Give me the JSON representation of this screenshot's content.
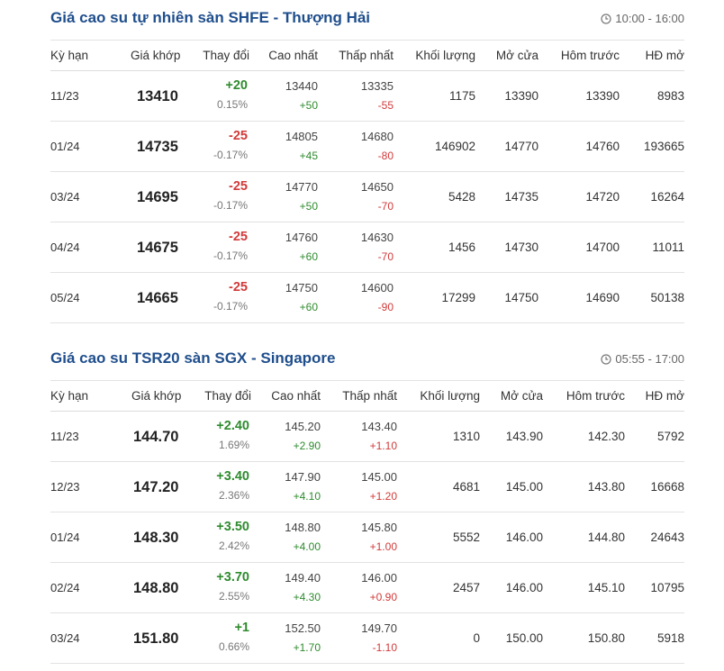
{
  "colors": {
    "title": "#1f4e8c",
    "up": "#2e8b2e",
    "down": "#d23a3a"
  },
  "headers": [
    "Kỳ hạn",
    "Giá khớp",
    "Thay đổi",
    "Cao nhất",
    "Thấp nhất",
    "Khối lượng",
    "Mở cửa",
    "Hôm trước",
    "HĐ mở"
  ],
  "sections": [
    {
      "title": "Giá cao su tự nhiên sàn SHFE - Thượng Hải",
      "time": "10:00 - 16:00",
      "clock_icon": "clock-icon",
      "rows": [
        {
          "term": "11/23",
          "price": "13410",
          "change": "+20",
          "change_dir": "up",
          "pct": "0.15%",
          "high": "13440",
          "high_delta": "+50",
          "high_dir": "up",
          "low": "13335",
          "low_delta": "-55",
          "low_dir": "down",
          "volume": "1175",
          "open": "13390",
          "prev": "13390",
          "oi": "8983"
        },
        {
          "term": "01/24",
          "price": "14735",
          "change": "-25",
          "change_dir": "down",
          "pct": "-0.17%",
          "high": "14805",
          "high_delta": "+45",
          "high_dir": "up",
          "low": "14680",
          "low_delta": "-80",
          "low_dir": "down",
          "volume": "146902",
          "open": "14770",
          "prev": "14760",
          "oi": "193665"
        },
        {
          "term": "03/24",
          "price": "14695",
          "change": "-25",
          "change_dir": "down",
          "pct": "-0.17%",
          "high": "14770",
          "high_delta": "+50",
          "high_dir": "up",
          "low": "14650",
          "low_delta": "-70",
          "low_dir": "down",
          "volume": "5428",
          "open": "14735",
          "prev": "14720",
          "oi": "16264"
        },
        {
          "term": "04/24",
          "price": "14675",
          "change": "-25",
          "change_dir": "down",
          "pct": "-0.17%",
          "high": "14760",
          "high_delta": "+60",
          "high_dir": "up",
          "low": "14630",
          "low_delta": "-70",
          "low_dir": "down",
          "volume": "1456",
          "open": "14730",
          "prev": "14700",
          "oi": "11011"
        },
        {
          "term": "05/24",
          "price": "14665",
          "change": "-25",
          "change_dir": "down",
          "pct": "-0.17%",
          "high": "14750",
          "high_delta": "+60",
          "high_dir": "up",
          "low": "14600",
          "low_delta": "-90",
          "low_dir": "down",
          "volume": "17299",
          "open": "14750",
          "prev": "14690",
          "oi": "50138"
        }
      ]
    },
    {
      "title": "Giá cao su TSR20 sàn SGX - Singapore",
      "time": "05:55 - 17:00",
      "clock_icon": "clock-icon",
      "rows": [
        {
          "term": "11/23",
          "price": "144.70",
          "change": "+2.40",
          "change_dir": "up",
          "pct": "1.69%",
          "high": "145.20",
          "high_delta": "+2.90",
          "high_dir": "up",
          "low": "143.40",
          "low_delta": "+1.10",
          "low_dir": "down",
          "volume": "1310",
          "open": "143.90",
          "prev": "142.30",
          "oi": "5792"
        },
        {
          "term": "12/23",
          "price": "147.20",
          "change": "+3.40",
          "change_dir": "up",
          "pct": "2.36%",
          "high": "147.90",
          "high_delta": "+4.10",
          "high_dir": "up",
          "low": "145.00",
          "low_delta": "+1.20",
          "low_dir": "down",
          "volume": "4681",
          "open": "145.00",
          "prev": "143.80",
          "oi": "16668"
        },
        {
          "term": "01/24",
          "price": "148.30",
          "change": "+3.50",
          "change_dir": "up",
          "pct": "2.42%",
          "high": "148.80",
          "high_delta": "+4.00",
          "high_dir": "up",
          "low": "145.80",
          "low_delta": "+1.00",
          "low_dir": "down",
          "volume": "5552",
          "open": "146.00",
          "prev": "144.80",
          "oi": "24643"
        },
        {
          "term": "02/24",
          "price": "148.80",
          "change": "+3.70",
          "change_dir": "up",
          "pct": "2.55%",
          "high": "149.40",
          "high_delta": "+4.30",
          "high_dir": "up",
          "low": "146.00",
          "low_delta": "+0.90",
          "low_dir": "down",
          "volume": "2457",
          "open": "146.00",
          "prev": "145.10",
          "oi": "10795"
        },
        {
          "term": "03/24",
          "price": "151.80",
          "change": "+1",
          "change_dir": "up",
          "pct": "0.66%",
          "high": "152.50",
          "high_delta": "+1.70",
          "high_dir": "up",
          "low": "149.70",
          "low_delta": "-1.10",
          "low_dir": "down",
          "volume": "0",
          "open": "150.00",
          "prev": "150.80",
          "oi": "5918"
        }
      ]
    }
  ]
}
